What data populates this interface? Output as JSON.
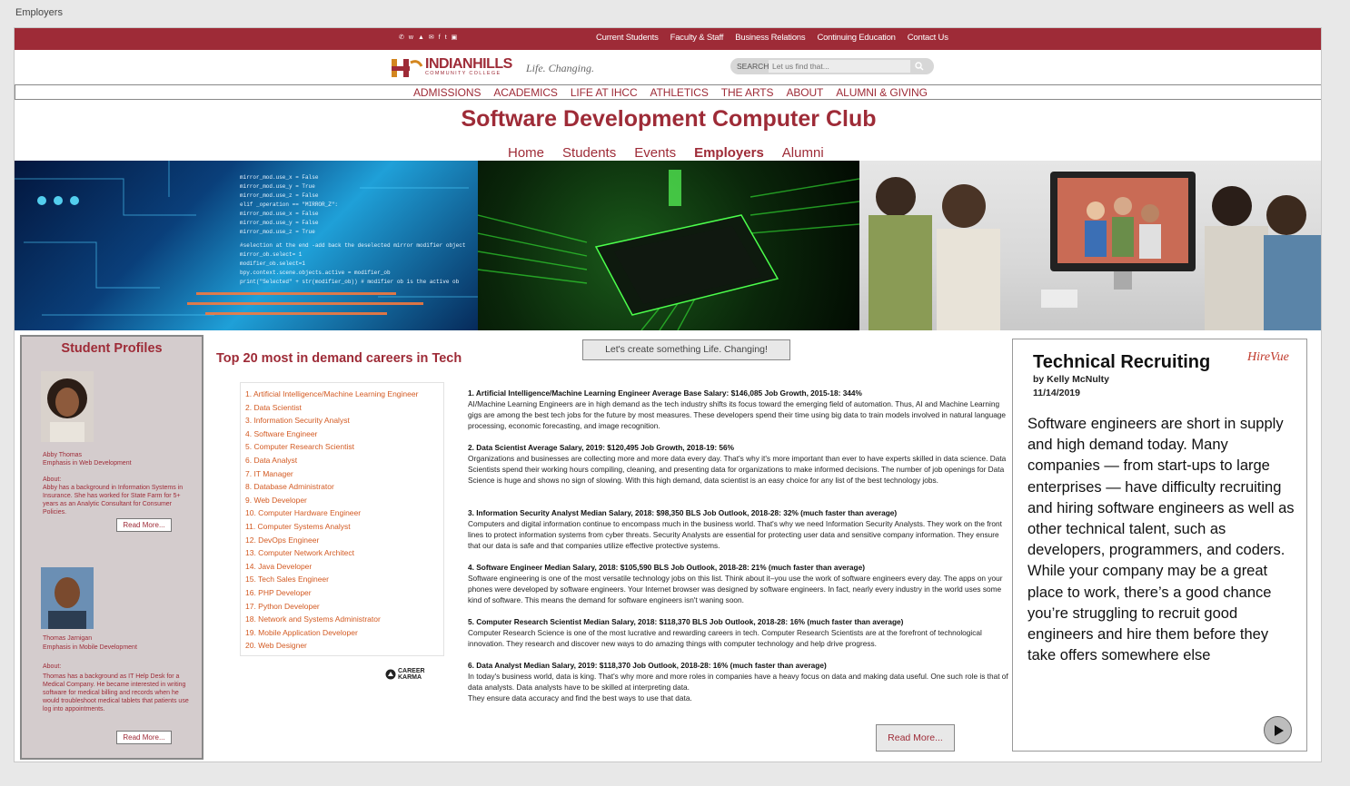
{
  "window": {
    "title": "Employers"
  },
  "topbar": {
    "social_icons": [
      "phone-icon",
      "whatsapp-icon",
      "snapchat-icon",
      "email-icon",
      "facebook-icon",
      "twitter-icon",
      "instagram-icon"
    ],
    "links": [
      "Current Students",
      "Faculty & Staff",
      "Business Relations",
      "Continuing Education",
      "Contact Us"
    ]
  },
  "header": {
    "logo_main": "INDIANHILLS",
    "logo_sub": "COMMUNITY COLLEGE",
    "tagline": "Life. Changing.",
    "search_label": "SEARCH",
    "search_placeholder": "Let us find that..."
  },
  "mainnav": [
    "ADMISSIONS",
    "ACADEMICS",
    "LIFE AT IHCC",
    "ATHLETICS",
    "THE ARTS",
    "ABOUT",
    "ALUMNI & GIVING"
  ],
  "club_title": "Software Development Computer Club",
  "subnav": {
    "items": [
      "Home",
      "Students",
      "Events",
      "Employers",
      "Alumni"
    ],
    "active": "Employers"
  },
  "profiles": {
    "heading": "Student Profiles",
    "people": [
      {
        "name": "Abby Thomas",
        "emphasis": " Emphasis in Web Development",
        "about_label": "About:",
        "about": "Abby has a background in Information Systems in Insurance. She has worked for State Farm for 5+ years as an Analytic Consultant for Consumer Policies.",
        "button": "Read More..."
      },
      {
        "name": "Thomas Jarnigan",
        "emphasis": "  Emphasis in Mobile Development",
        "about_label": "About:",
        "about": "Thomas  has a background as IT Help Desk for a Medical Company. He became interested in writing software for medical billing and records when he would troubleshoot medical tablets that patients use log into appointments.",
        "button": "Read More..."
      }
    ]
  },
  "careers": {
    "title": "Top 20 most in demand careers in Tech",
    "cta": "Let's create something Life. Changing!",
    "list": [
      "1. Artificial Intelligence/Machine Learning Engineer",
      "2. Data Scientist",
      "3. Information Security Analyst",
      "4. Software Engineer",
      "5. Computer Research Scientist",
      "6. Data Analyst",
      "7. IT Manager",
      "8. Database Administrator",
      "9. Web Developer",
      "10. Computer Hardware Engineer",
      "11. Computer Systems Analyst",
      "12. DevOps Engineer",
      "13. Computer Network Architect",
      "14. Java Developer",
      "15. Tech Sales Engineer",
      "16. PHP Developer",
      "17. Python Developer",
      "18. Network and Systems Administrator",
      "19. Mobile Application Developer",
      "20. Web Designer"
    ],
    "source_logo_line1": "CAREER",
    "source_logo_line2": "KARMA",
    "details": [
      {
        "heading": "1. Artificial Intelligence/Machine Learning Engineer  Average Base Salary: $146,085  Job Growth, 2015-18: 344%",
        "body": "AI/Machine Learning Engineers are in high demand as the tech industry shifts its focus toward the emerging field of automation. Thus, AI and Machine Learning gigs are among the best tech jobs for the future by most measures. These developers spend their time using big data to train models involved in natural language processing, economic forecasting, and image recognition."
      },
      {
        "heading": "2. Data Scientist Average Salary, 2019: $120,495  Job Growth, 2018-19: 56%",
        "body": "Organizations and businesses are collecting more and more data every day. That's why it's more important than ever to have experts skilled in data science. Data Scientists spend their working hours compiling, cleaning, and presenting data for organizations to make informed decisions. The number of job openings for Data Science is huge and shows no sign of slowing. With this high demand, data scientist is an easy choice for any list of the best technology jobs."
      },
      {
        "heading": "3. Information Security Analyst  Median Salary, 2018: $98,350  BLS Job Outlook, 2018-28: 32% (much faster than average)",
        "body": "Computers and digital information continue to encompass much in the business world. That's why we need Information Security Analysts. They work on the front lines to protect information systems from cyber threats. Security Analysts are essential for protecting user data and sensitive company information. They ensure that our data is safe and that companies utilize effective protective systems."
      },
      {
        "heading": "4. Software Engineer  Median Salary, 2018: $105,590  BLS Job Outlook, 2018-28: 21% (much faster than average)",
        "body": "Software engineering is one of the most versatile technology jobs on this list. Think about it–you use the work of software engineers every day. The apps on your phones were developed by software engineers. Your Internet browser was designed by software engineers. In fact, nearly every industry in the world uses some kind of software. This means the demand for software engineers isn't waning soon."
      },
      {
        "heading": "5. Computer Research Scientist  Median Salary, 2018: $118,370  BLS Job Outlook, 2018-28: 16% (much faster than average)",
        "body": "Computer Research Science is one of the most lucrative and rewarding careers in tech. Computer Research Scientists are at the forefront of technological innovation. They research and discover new ways to do amazing things with computer technology and help drive progress."
      },
      {
        "heading": "6. Data Analyst  Median Salary, 2019: $118,370   Job Outlook, 2018-28: 16% (much faster than average)",
        "body": "In today's business world, data is king. That's why more and more roles in companies have a heavy focus on data and making data useful. One such role is that of data analysts. Data analysts have to be skilled at interpreting data.\nThey ensure data accuracy and find the best ways to use that data."
      }
    ],
    "read_more": "Read More..."
  },
  "article": {
    "title": "Technical Recruiting",
    "brand": "HireVue",
    "author": "by Kelly McNulty",
    "date": "11/14/2019",
    "body": "Software engineers are short in supply and high demand today. Many companies — from start-ups to large enterprises — have difficulty recruiting and hiring software engineers as well as other technical talent, such as developers, programmers, and coders. While your company may be a great place to work, there’s a good chance you’re struggling to recruit good engineers and hire them before they take offers somewhere else",
    "play_icon": "play-icon"
  },
  "colors": {
    "brand": "#9e2b37",
    "list_orange": "#d35a22",
    "profile_bg": "#d4cccd"
  }
}
